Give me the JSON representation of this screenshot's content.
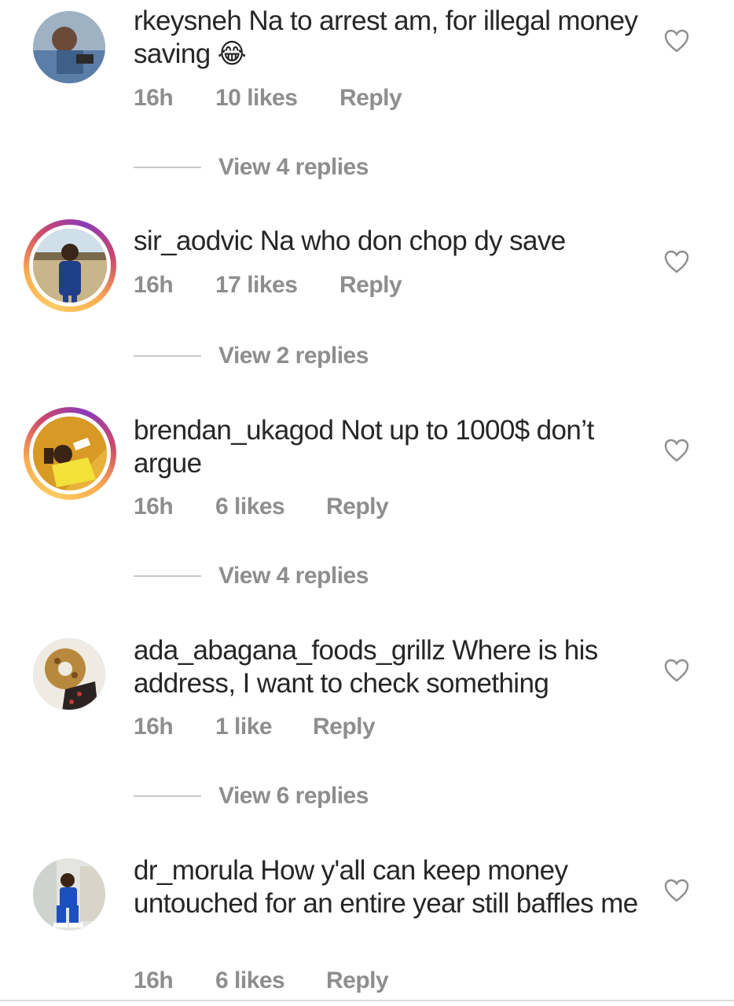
{
  "comments": [
    {
      "username": "rkeysneh",
      "text": "Na to arrest am, for illegal money saving 😂",
      "time": "16h",
      "likes": "10 likes",
      "reply": "Reply",
      "view_replies": "View 4 replies",
      "story_ring": false
    },
    {
      "username": "sir_aodvic",
      "text": "Na who don chop dy save",
      "time": "16h",
      "likes": "17 likes",
      "reply": "Reply",
      "view_replies": "View 2 replies",
      "story_ring": true
    },
    {
      "username": "brendan_ukagod",
      "text": "Not up to 1000$ don’t argue",
      "time": "16h",
      "likes": "6 likes",
      "reply": "Reply",
      "view_replies": "View 4 replies",
      "story_ring": true
    },
    {
      "username": "ada_abagana_foods_grillz",
      "text": "Where is his address, I want to check something",
      "time": "16h",
      "likes": "1 like",
      "reply": "Reply",
      "view_replies": "View 6 replies",
      "story_ring": false
    },
    {
      "username": "dr_morula",
      "text": "How y'all can keep money untouched for an entire year still baffles me",
      "time": "16h",
      "likes": "6 likes",
      "reply": "Reply",
      "story_ring": false
    }
  ],
  "colors": {
    "text": "#262626",
    "meta": "#8e8e8e",
    "story_ring_start": "#fccc63",
    "story_ring_end": "#8a3ab9"
  },
  "icons": {
    "like": "heart-outline-icon"
  }
}
